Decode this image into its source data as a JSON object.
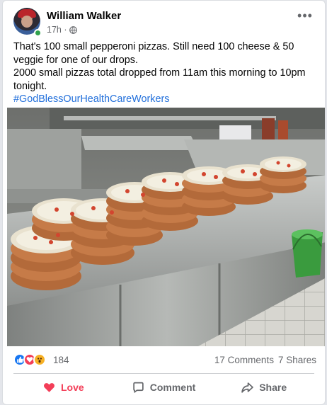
{
  "post": {
    "author_name": "William Walker",
    "time": "17h ·",
    "more_label": "•••",
    "text_lines": [
      "That's 100 small pepperoni pizzas. Still need 100 cheese & 50 veggie for one of our drops.",
      "2000 small pizzas total dropped from 11am this morning to 10pm tonight."
    ],
    "hashtag": "#GodBlessOurHealthCareWorkers"
  },
  "reactions": {
    "count": "184",
    "icons": [
      "like-icon",
      "love-icon",
      "wow-icon"
    ],
    "comments": "17 Comments",
    "shares": "7 Shares"
  },
  "actions": {
    "love": "Love",
    "comment": "Comment",
    "share": "Share"
  },
  "colors": {
    "like": "#1877f2",
    "love": "#f33e58",
    "wow": "#f7b125",
    "hashtag": "#216fdb",
    "online": "#31a24c"
  }
}
